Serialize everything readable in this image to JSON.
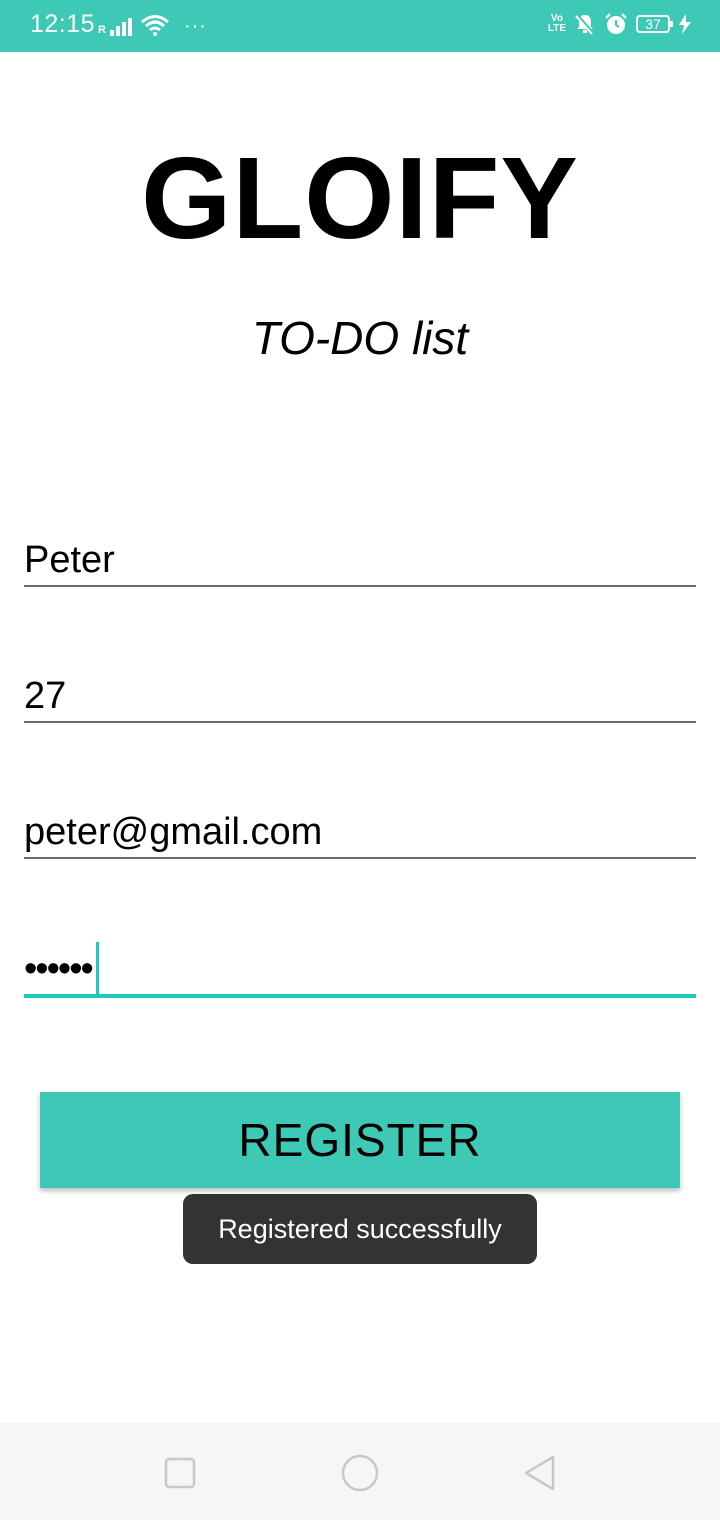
{
  "status_bar": {
    "time": "12:15",
    "battery": "37",
    "colors": {
      "background": "#3ec9b6"
    },
    "icons": [
      "signal-icon",
      "wifi-icon",
      "more-dots-icon",
      "volte-icon",
      "mute-icon",
      "alarm-icon",
      "battery-icon",
      "charging-icon"
    ]
  },
  "app": {
    "title": "GLOIFY",
    "subtitle": "TO-DO list"
  },
  "form": {
    "name": "Peter",
    "age": "27",
    "email": "peter@gmail.com",
    "password_masked": "••••••",
    "register_label": "REGISTER"
  },
  "toast": {
    "message": "Registered successfully"
  },
  "accent_color": "#20c9bd",
  "nav_bar": {
    "icons": [
      "recents-icon",
      "home-icon",
      "back-icon"
    ]
  }
}
